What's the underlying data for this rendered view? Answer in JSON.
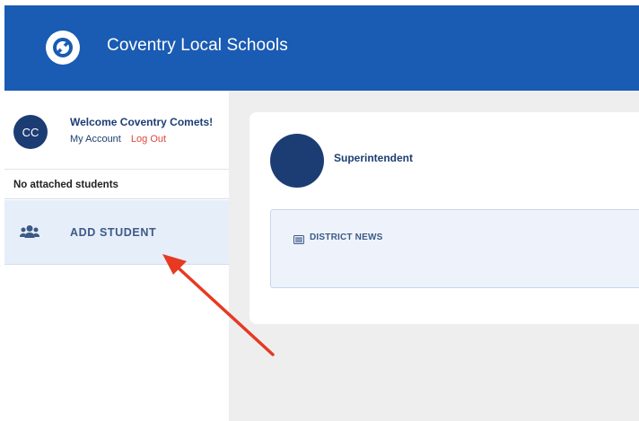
{
  "header": {
    "app_title": "Coventry Local Schools",
    "logo_icon": "district-logo-icon",
    "background_color": "#1a5bb3"
  },
  "sidebar": {
    "profile": {
      "avatar_initials": "CC",
      "welcome_text": "Welcome Coventry Comets!",
      "my_account_label": "My Account",
      "log_out_label": "Log Out"
    },
    "students_status": "No attached students",
    "add_student": {
      "icon": "users-group-icon",
      "label": "ADD STUDENT"
    }
  },
  "main": {
    "card": {
      "title": "Superintendent",
      "news": {
        "icon": "newspaper-icon",
        "label": "DISTRICT NEWS"
      }
    }
  },
  "annotation": {
    "type": "red-arrow",
    "points_to": "add-student-button",
    "color": "#e63a22"
  }
}
